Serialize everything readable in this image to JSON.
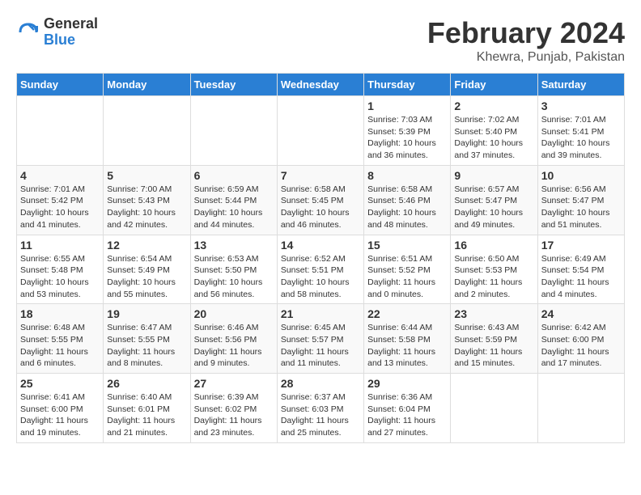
{
  "logo": {
    "general": "General",
    "blue": "Blue"
  },
  "title": "February 2024",
  "subtitle": "Khewra, Punjab, Pakistan",
  "days_of_week": [
    "Sunday",
    "Monday",
    "Tuesday",
    "Wednesday",
    "Thursday",
    "Friday",
    "Saturday"
  ],
  "weeks": [
    [
      {
        "num": "",
        "sunrise": "",
        "sunset": "",
        "daylight": ""
      },
      {
        "num": "",
        "sunrise": "",
        "sunset": "",
        "daylight": ""
      },
      {
        "num": "",
        "sunrise": "",
        "sunset": "",
        "daylight": ""
      },
      {
        "num": "",
        "sunrise": "",
        "sunset": "",
        "daylight": ""
      },
      {
        "num": "1",
        "sunrise": "7:03 AM",
        "sunset": "5:39 PM",
        "daylight": "10 hours and 36 minutes."
      },
      {
        "num": "2",
        "sunrise": "7:02 AM",
        "sunset": "5:40 PM",
        "daylight": "10 hours and 37 minutes."
      },
      {
        "num": "3",
        "sunrise": "7:01 AM",
        "sunset": "5:41 PM",
        "daylight": "10 hours and 39 minutes."
      }
    ],
    [
      {
        "num": "4",
        "sunrise": "7:01 AM",
        "sunset": "5:42 PM",
        "daylight": "10 hours and 41 minutes."
      },
      {
        "num": "5",
        "sunrise": "7:00 AM",
        "sunset": "5:43 PM",
        "daylight": "10 hours and 42 minutes."
      },
      {
        "num": "6",
        "sunrise": "6:59 AM",
        "sunset": "5:44 PM",
        "daylight": "10 hours and 44 minutes."
      },
      {
        "num": "7",
        "sunrise": "6:58 AM",
        "sunset": "5:45 PM",
        "daylight": "10 hours and 46 minutes."
      },
      {
        "num": "8",
        "sunrise": "6:58 AM",
        "sunset": "5:46 PM",
        "daylight": "10 hours and 48 minutes."
      },
      {
        "num": "9",
        "sunrise": "6:57 AM",
        "sunset": "5:47 PM",
        "daylight": "10 hours and 49 minutes."
      },
      {
        "num": "10",
        "sunrise": "6:56 AM",
        "sunset": "5:47 PM",
        "daylight": "10 hours and 51 minutes."
      }
    ],
    [
      {
        "num": "11",
        "sunrise": "6:55 AM",
        "sunset": "5:48 PM",
        "daylight": "10 hours and 53 minutes."
      },
      {
        "num": "12",
        "sunrise": "6:54 AM",
        "sunset": "5:49 PM",
        "daylight": "10 hours and 55 minutes."
      },
      {
        "num": "13",
        "sunrise": "6:53 AM",
        "sunset": "5:50 PM",
        "daylight": "10 hours and 56 minutes."
      },
      {
        "num": "14",
        "sunrise": "6:52 AM",
        "sunset": "5:51 PM",
        "daylight": "10 hours and 58 minutes."
      },
      {
        "num": "15",
        "sunrise": "6:51 AM",
        "sunset": "5:52 PM",
        "daylight": "11 hours and 0 minutes."
      },
      {
        "num": "16",
        "sunrise": "6:50 AM",
        "sunset": "5:53 PM",
        "daylight": "11 hours and 2 minutes."
      },
      {
        "num": "17",
        "sunrise": "6:49 AM",
        "sunset": "5:54 PM",
        "daylight": "11 hours and 4 minutes."
      }
    ],
    [
      {
        "num": "18",
        "sunrise": "6:48 AM",
        "sunset": "5:55 PM",
        "daylight": "11 hours and 6 minutes."
      },
      {
        "num": "19",
        "sunrise": "6:47 AM",
        "sunset": "5:55 PM",
        "daylight": "11 hours and 8 minutes."
      },
      {
        "num": "20",
        "sunrise": "6:46 AM",
        "sunset": "5:56 PM",
        "daylight": "11 hours and 9 minutes."
      },
      {
        "num": "21",
        "sunrise": "6:45 AM",
        "sunset": "5:57 PM",
        "daylight": "11 hours and 11 minutes."
      },
      {
        "num": "22",
        "sunrise": "6:44 AM",
        "sunset": "5:58 PM",
        "daylight": "11 hours and 13 minutes."
      },
      {
        "num": "23",
        "sunrise": "6:43 AM",
        "sunset": "5:59 PM",
        "daylight": "11 hours and 15 minutes."
      },
      {
        "num": "24",
        "sunrise": "6:42 AM",
        "sunset": "6:00 PM",
        "daylight": "11 hours and 17 minutes."
      }
    ],
    [
      {
        "num": "25",
        "sunrise": "6:41 AM",
        "sunset": "6:00 PM",
        "daylight": "11 hours and 19 minutes."
      },
      {
        "num": "26",
        "sunrise": "6:40 AM",
        "sunset": "6:01 PM",
        "daylight": "11 hours and 21 minutes."
      },
      {
        "num": "27",
        "sunrise": "6:39 AM",
        "sunset": "6:02 PM",
        "daylight": "11 hours and 23 minutes."
      },
      {
        "num": "28",
        "sunrise": "6:37 AM",
        "sunset": "6:03 PM",
        "daylight": "11 hours and 25 minutes."
      },
      {
        "num": "29",
        "sunrise": "6:36 AM",
        "sunset": "6:04 PM",
        "daylight": "11 hours and 27 minutes."
      },
      {
        "num": "",
        "sunrise": "",
        "sunset": "",
        "daylight": ""
      },
      {
        "num": "",
        "sunrise": "",
        "sunset": "",
        "daylight": ""
      }
    ]
  ]
}
